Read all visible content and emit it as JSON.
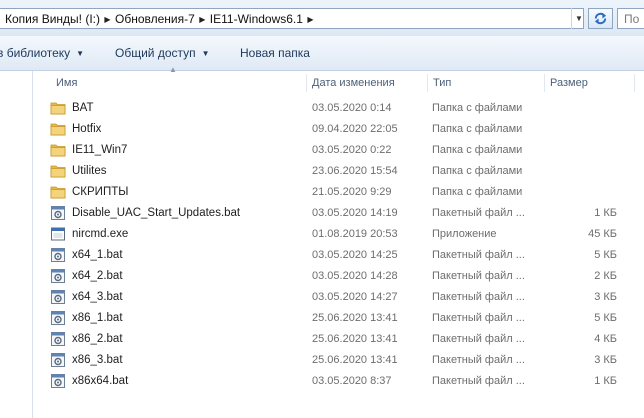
{
  "address_bar": {
    "crumbs": [
      "Копия Винды! (I:)",
      "Обновления-7",
      "IE11-Windows6.1"
    ],
    "search_placeholder": "По"
  },
  "toolbar": {
    "library_label": "в библиотеку",
    "share_label": "Общий доступ",
    "new_folder_label": "Новая папка"
  },
  "columns": {
    "name": "Имя",
    "date": "Дата изменения",
    "type": "Тип",
    "size": "Размер"
  },
  "files": [
    {
      "icon": "folder-icon",
      "name": "BAT",
      "date": "03.05.2020 0:14",
      "type": "Папка с файлами",
      "size": ""
    },
    {
      "icon": "folder-icon",
      "name": "Hotfix",
      "date": "09.04.2020 22:05",
      "type": "Папка с файлами",
      "size": ""
    },
    {
      "icon": "folder-icon",
      "name": "IE11_Win7",
      "date": "03.05.2020 0:22",
      "type": "Папка с файлами",
      "size": ""
    },
    {
      "icon": "folder-icon",
      "name": "Utilites",
      "date": "23.06.2020 15:54",
      "type": "Папка с файлами",
      "size": ""
    },
    {
      "icon": "folder-icon",
      "name": "СКРИПТЫ",
      "date": "21.05.2020 9:29",
      "type": "Папка с файлами",
      "size": ""
    },
    {
      "icon": "bat-file-icon",
      "name": "Disable_UAC_Start_Updates.bat",
      "date": "03.05.2020 14:19",
      "type": "Пакетный файл ...",
      "size": "1 КБ"
    },
    {
      "icon": "exe-file-icon",
      "name": "nircmd.exe",
      "date": "01.08.2019 20:53",
      "type": "Приложение",
      "size": "45 КБ"
    },
    {
      "icon": "bat-file-icon",
      "name": "x64_1.bat",
      "date": "03.05.2020 14:25",
      "type": "Пакетный файл ...",
      "size": "5 КБ"
    },
    {
      "icon": "bat-file-icon",
      "name": "x64_2.bat",
      "date": "03.05.2020 14:28",
      "type": "Пакетный файл ...",
      "size": "2 КБ"
    },
    {
      "icon": "bat-file-icon",
      "name": "x64_3.bat",
      "date": "03.05.2020 14:27",
      "type": "Пакетный файл ...",
      "size": "3 КБ"
    },
    {
      "icon": "bat-file-icon",
      "name": "x86_1.bat",
      "date": "25.06.2020 13:41",
      "type": "Пакетный файл ...",
      "size": "5 КБ"
    },
    {
      "icon": "bat-file-icon",
      "name": "x86_2.bat",
      "date": "25.06.2020 13:41",
      "type": "Пакетный файл ...",
      "size": "4 КБ"
    },
    {
      "icon": "bat-file-icon",
      "name": "x86_3.bat",
      "date": "25.06.2020 13:41",
      "type": "Пакетный файл ...",
      "size": "3 КБ"
    },
    {
      "icon": "bat-file-icon",
      "name": "x86x64.bat",
      "date": "03.05.2020 8:37",
      "type": "Пакетный файл ...",
      "size": "1 КБ"
    }
  ]
}
